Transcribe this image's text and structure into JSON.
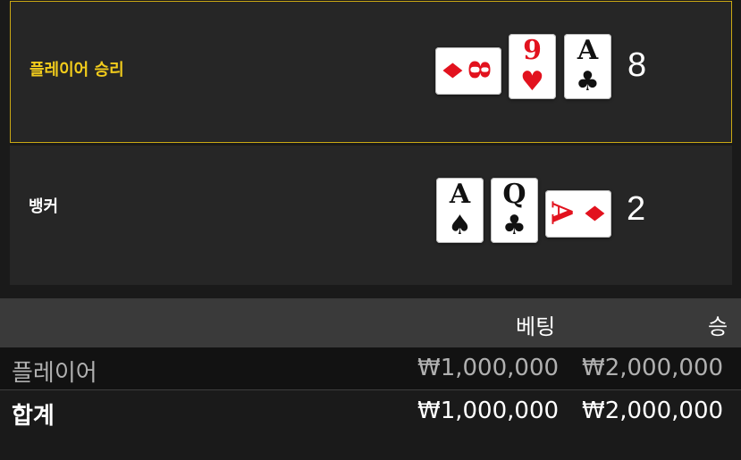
{
  "player": {
    "label": "플레이어 승리",
    "score": "8",
    "cards": [
      {
        "rank": "8",
        "suit": "♦",
        "color": "red",
        "orientation": "sideways"
      },
      {
        "rank": "9",
        "suit": "♥",
        "color": "red",
        "orientation": "upright"
      },
      {
        "rank": "A",
        "suit": "♣",
        "color": "black",
        "orientation": "upright"
      }
    ]
  },
  "banker": {
    "label": "뱅커",
    "score": "2",
    "cards": [
      {
        "rank": "A",
        "suit": "♠",
        "color": "black",
        "orientation": "upright"
      },
      {
        "rank": "Q",
        "suit": "♣",
        "color": "black",
        "orientation": "upright"
      },
      {
        "rank": "A",
        "suit": "♦",
        "color": "red",
        "orientation": "sideways"
      }
    ]
  },
  "table": {
    "headers": {
      "bet": "베팅",
      "win": "승"
    },
    "rows": [
      {
        "label": "플레이어",
        "bet": "₩1,000,000",
        "win": "₩2,000,000"
      },
      {
        "label": "합계",
        "bet": "₩1,000,000",
        "win": "₩2,000,000"
      }
    ]
  },
  "colors": {
    "highlight": "#f2cc1c",
    "red_suit": "#e2121e"
  }
}
